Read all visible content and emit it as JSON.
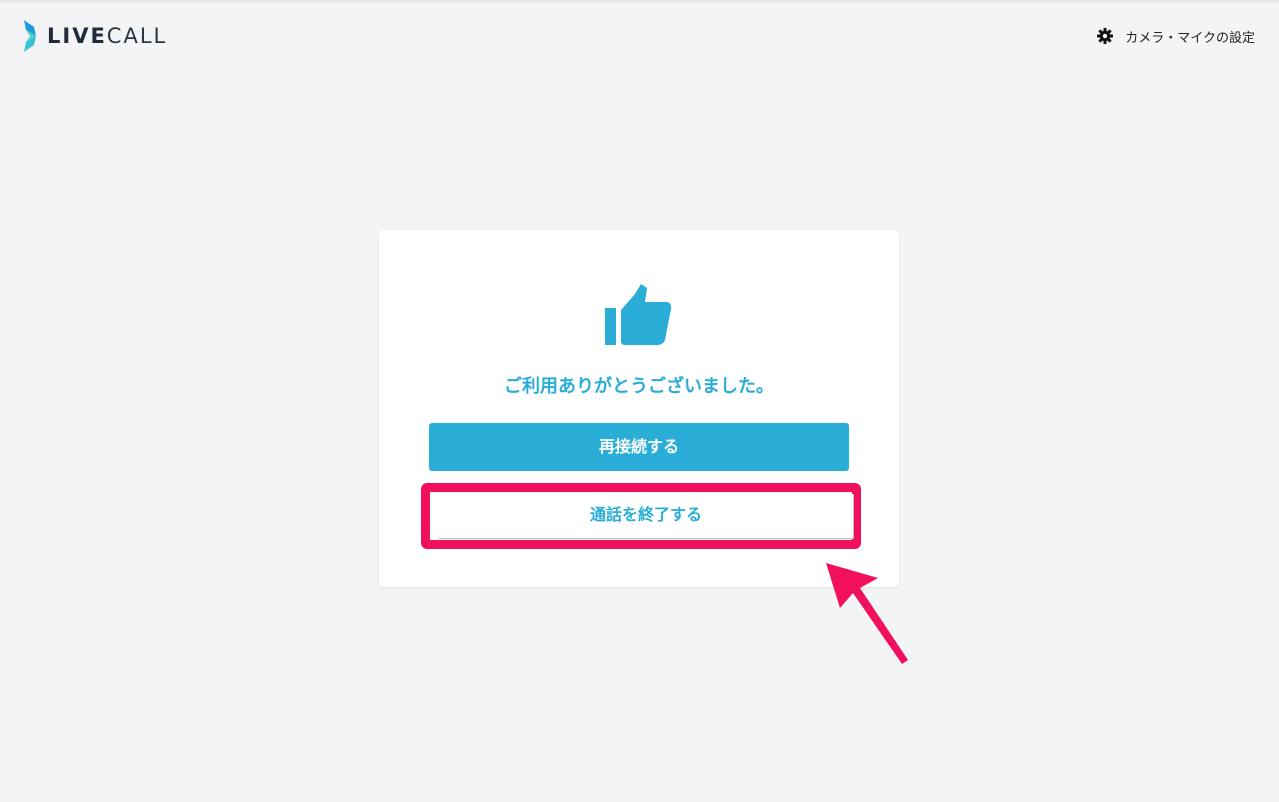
{
  "header": {
    "logo_text_bold": "LIVE",
    "logo_text_thin": "CALL",
    "settings_label": "カメラ・マイクの設定"
  },
  "card": {
    "icon": "thumbs-up-icon",
    "message": "ご利用ありがとうございました。",
    "reconnect_label": "再接続する",
    "end_call_label": "通話を終了する"
  },
  "colors": {
    "accent": "#2aaed8",
    "highlight": "#f0105c",
    "background": "#f3f4f6"
  }
}
